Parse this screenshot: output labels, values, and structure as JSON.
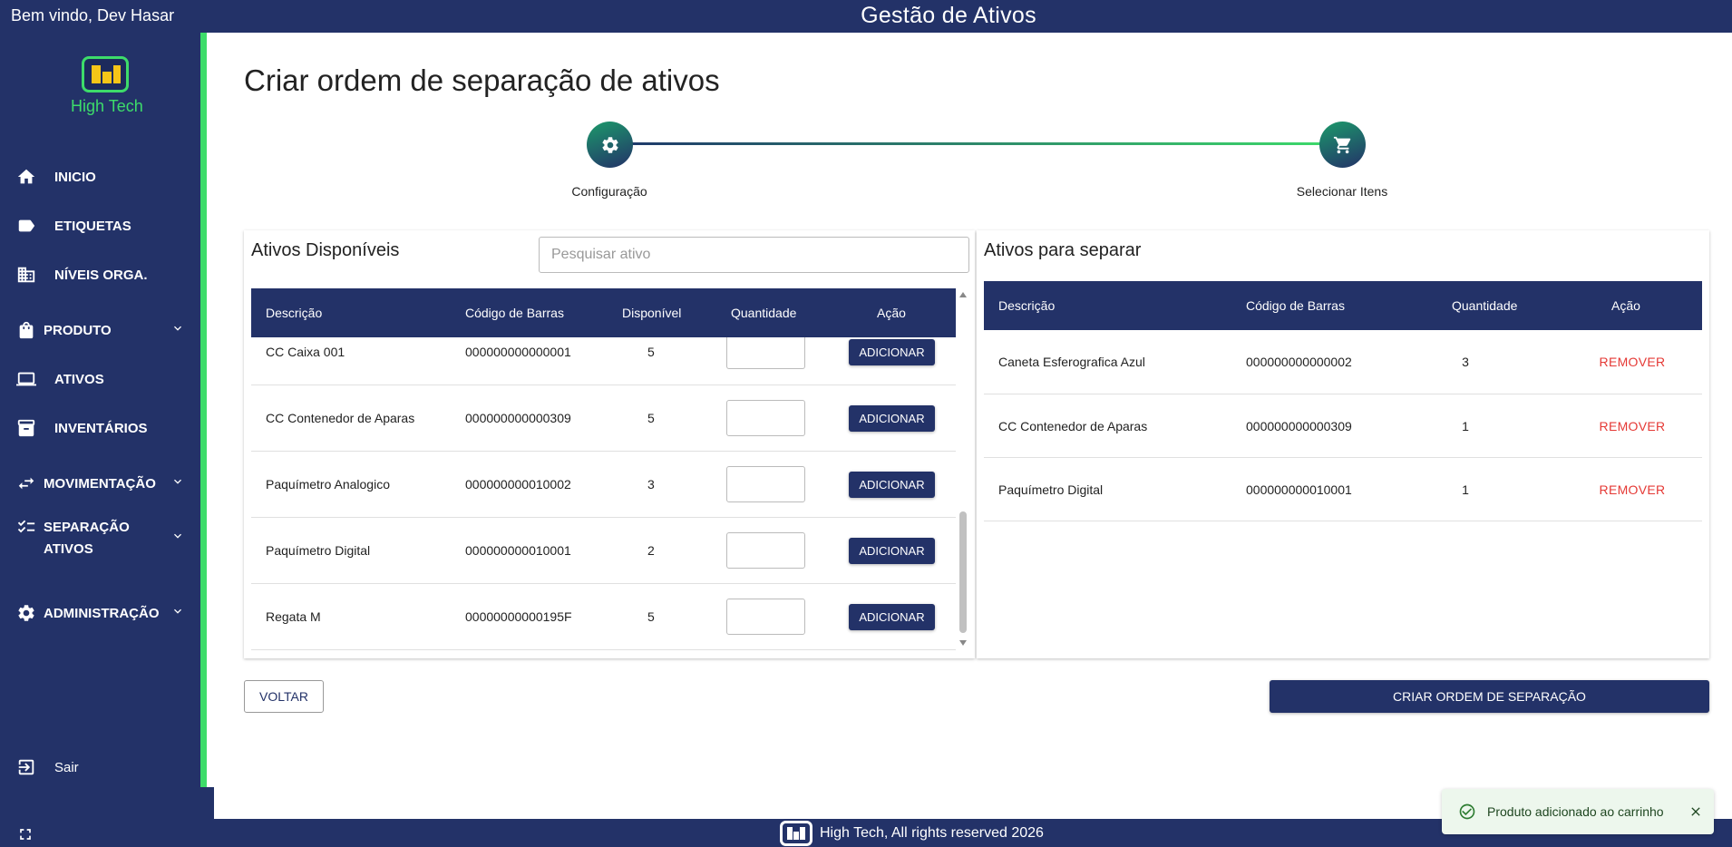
{
  "header": {
    "welcome": "Bem vindo, Dev Hasar",
    "app_title": "Gestão de Ativos"
  },
  "sidebar": {
    "logo_text": "High Tech",
    "items": [
      {
        "label": "INICIO",
        "icon": "home-icon"
      },
      {
        "label": "ETIQUETAS",
        "icon": "label-icon"
      },
      {
        "label": "NÍVEIS ORGA.",
        "icon": "building-icon"
      },
      {
        "label": "PRODUTO",
        "icon": "shopping-bag-icon"
      },
      {
        "label": "ATIVOS",
        "icon": "laptop-icon"
      },
      {
        "label": "INVENTÁRIOS",
        "icon": "archive-icon"
      },
      {
        "label": "MOVIMENTAÇÃO",
        "icon": "swap-icon"
      },
      {
        "label_line1": "SEPARAÇÃO",
        "label_line2": "ATIVOS",
        "icon": "checklist-icon"
      },
      {
        "label": "ADMINISTRAÇÃO",
        "icon": "gear-icon"
      }
    ],
    "logout": "Sair"
  },
  "page": {
    "title": "Criar ordem de separação de ativos"
  },
  "stepper": {
    "steps": [
      {
        "label": "Configuração",
        "icon": "gear-icon"
      },
      {
        "label": "Selecionar Itens",
        "icon": "cart-icon"
      }
    ]
  },
  "available": {
    "title": "Ativos Disponíveis",
    "search_placeholder": "Pesquisar ativo",
    "columns": [
      "Descrição",
      "Código de Barras",
      "Disponível",
      "Quantidade",
      "Ação"
    ],
    "add_label": "ADICIONAR",
    "rows": [
      {
        "desc": "CC Caixa 001",
        "code": "000000000000001",
        "available": "5"
      },
      {
        "desc": "CC Contenedor de Aparas",
        "code": "000000000000309",
        "available": "5"
      },
      {
        "desc": "Paquímetro Analogico",
        "code": "000000000010002",
        "available": "3"
      },
      {
        "desc": "Paquímetro Digital",
        "code": "000000000010001",
        "available": "2"
      },
      {
        "desc": "Regata M",
        "code": "00000000000195F",
        "available": "5"
      }
    ]
  },
  "to_separate": {
    "title": "Ativos para separar",
    "columns": [
      "Descrição",
      "Código de Barras",
      "Quantidade",
      "Ação"
    ],
    "remove_label": "REMOVER",
    "rows": [
      {
        "desc": "Caneta Esferografica Azul",
        "code": "000000000000002",
        "qty": "3"
      },
      {
        "desc": "CC Contenedor de Aparas",
        "code": "000000000000309",
        "qty": "1"
      },
      {
        "desc": "Paquímetro Digital",
        "code": "000000000010001",
        "qty": "1"
      }
    ]
  },
  "actions": {
    "back": "VOLTAR",
    "create": "CRIAR ORDEM DE SEPARAÇÃO"
  },
  "footer": {
    "text": "High Tech, All rights reserved 2026"
  },
  "toast": {
    "message": "Produto adicionado ao carrinho"
  },
  "colors": {
    "primary": "#233268",
    "accent": "#3ddc6a",
    "danger": "#e53935"
  }
}
